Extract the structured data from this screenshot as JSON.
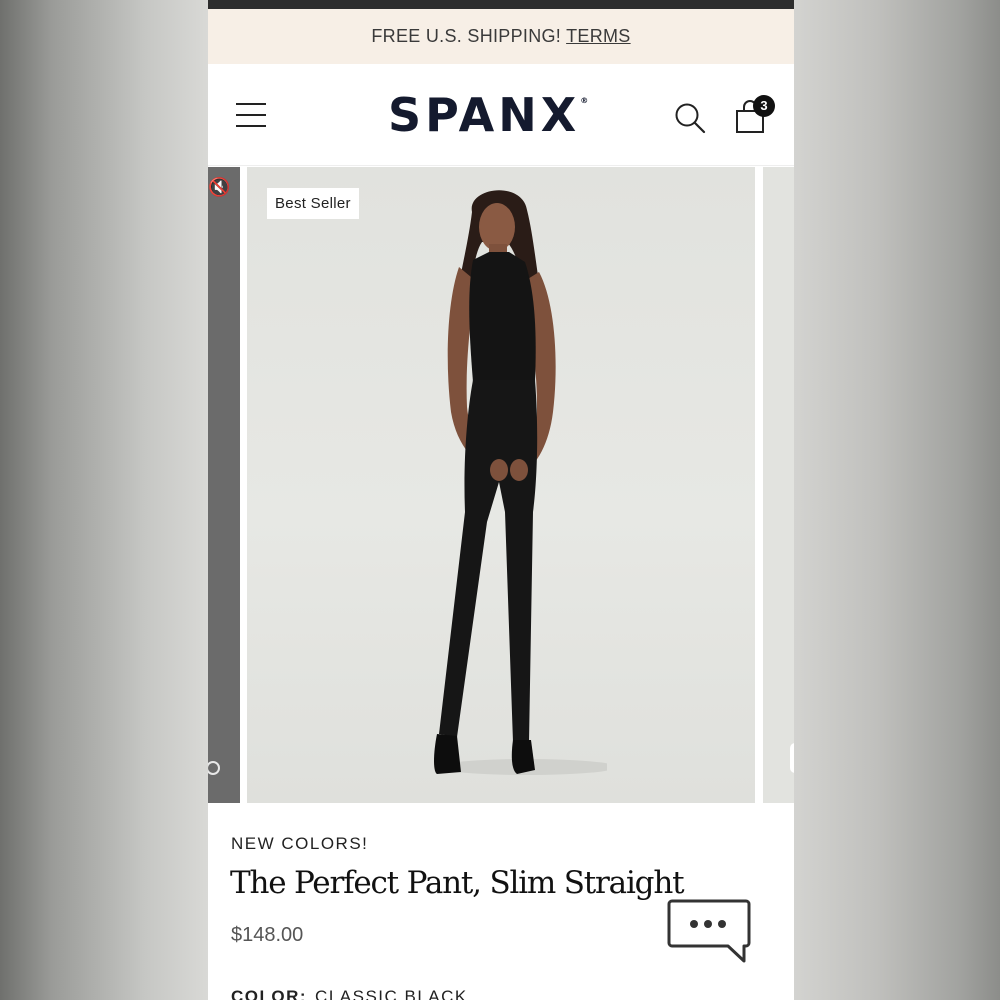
{
  "promo": {
    "text": "FREE U.S. SHIPPING!",
    "link": "TERMS"
  },
  "header": {
    "menu_icon": "hamburger-menu-icon",
    "logo": "SPANX",
    "logo_mark": "®",
    "search_icon": "search-icon",
    "cart_icon": "shopping-bag-icon",
    "cart_count": "3"
  },
  "gallery": {
    "badge": "Best Seller",
    "image_alt": "Model wearing black sleeveless turtleneck and black slim straight pants with black heels"
  },
  "product": {
    "eyebrow": "NEW COLORS!",
    "title": "The Perfect Pant, Slim Straight",
    "price": "$148.00",
    "color_label": "COLOR:",
    "color_value": "CLASSIC BLACK"
  },
  "chat": {
    "icon": "chat-bubble-icon"
  },
  "colors": {
    "promo_bg": "#f7efe6",
    "logo": "#141a2e",
    "photo_bg": "#e3e4e0"
  }
}
